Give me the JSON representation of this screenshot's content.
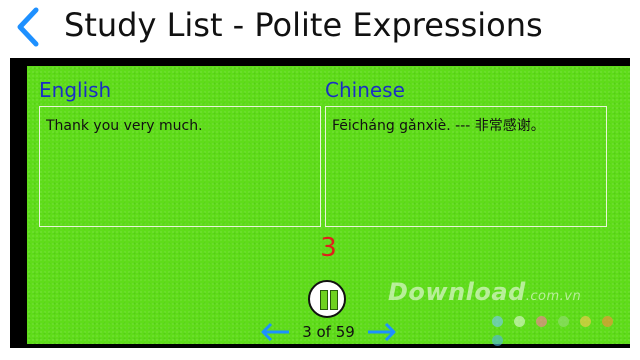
{
  "header": {
    "title": "Study List - Polite Expressions"
  },
  "card": {
    "english_label": "English",
    "chinese_label": "Chinese",
    "english_text": "Thank you very much.",
    "chinese_text": "Fēicháng gǎnxiè.  ---  非常感谢。"
  },
  "counter": "3",
  "navigation": {
    "page_text": "3 of 59"
  },
  "watermark": {
    "text": "Download",
    "suffix": ".com.vn"
  },
  "colors": {
    "board_green": "#5fdc1a",
    "label_blue": "#1a2fc4",
    "counter_red": "#e0201a",
    "accent_blue": "#1e90ff"
  }
}
